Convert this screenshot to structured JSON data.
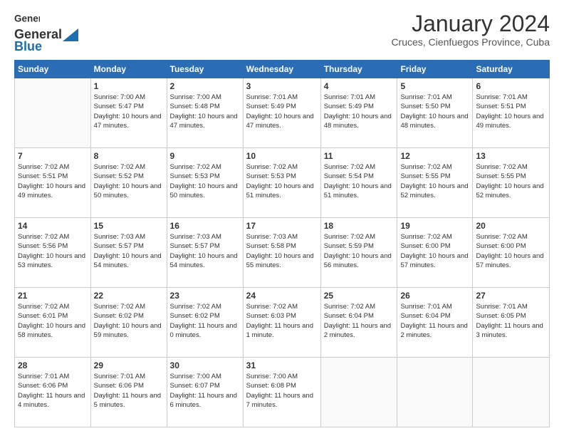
{
  "header": {
    "logo_general": "General",
    "logo_blue": "Blue",
    "month_title": "January 2024",
    "location": "Cruces, Cienfuegos Province, Cuba"
  },
  "weekdays": [
    "Sunday",
    "Monday",
    "Tuesday",
    "Wednesday",
    "Thursday",
    "Friday",
    "Saturday"
  ],
  "weeks": [
    [
      {
        "day": "",
        "sunrise": "",
        "sunset": "",
        "daylight": ""
      },
      {
        "day": "1",
        "sunrise": "Sunrise: 7:00 AM",
        "sunset": "Sunset: 5:47 PM",
        "daylight": "Daylight: 10 hours and 47 minutes."
      },
      {
        "day": "2",
        "sunrise": "Sunrise: 7:00 AM",
        "sunset": "Sunset: 5:48 PM",
        "daylight": "Daylight: 10 hours and 47 minutes."
      },
      {
        "day": "3",
        "sunrise": "Sunrise: 7:01 AM",
        "sunset": "Sunset: 5:49 PM",
        "daylight": "Daylight: 10 hours and 47 minutes."
      },
      {
        "day": "4",
        "sunrise": "Sunrise: 7:01 AM",
        "sunset": "Sunset: 5:49 PM",
        "daylight": "Daylight: 10 hours and 48 minutes."
      },
      {
        "day": "5",
        "sunrise": "Sunrise: 7:01 AM",
        "sunset": "Sunset: 5:50 PM",
        "daylight": "Daylight: 10 hours and 48 minutes."
      },
      {
        "day": "6",
        "sunrise": "Sunrise: 7:01 AM",
        "sunset": "Sunset: 5:51 PM",
        "daylight": "Daylight: 10 hours and 49 minutes."
      }
    ],
    [
      {
        "day": "7",
        "sunrise": "Sunrise: 7:02 AM",
        "sunset": "Sunset: 5:51 PM",
        "daylight": "Daylight: 10 hours and 49 minutes."
      },
      {
        "day": "8",
        "sunrise": "Sunrise: 7:02 AM",
        "sunset": "Sunset: 5:52 PM",
        "daylight": "Daylight: 10 hours and 50 minutes."
      },
      {
        "day": "9",
        "sunrise": "Sunrise: 7:02 AM",
        "sunset": "Sunset: 5:53 PM",
        "daylight": "Daylight: 10 hours and 50 minutes."
      },
      {
        "day": "10",
        "sunrise": "Sunrise: 7:02 AM",
        "sunset": "Sunset: 5:53 PM",
        "daylight": "Daylight: 10 hours and 51 minutes."
      },
      {
        "day": "11",
        "sunrise": "Sunrise: 7:02 AM",
        "sunset": "Sunset: 5:54 PM",
        "daylight": "Daylight: 10 hours and 51 minutes."
      },
      {
        "day": "12",
        "sunrise": "Sunrise: 7:02 AM",
        "sunset": "Sunset: 5:55 PM",
        "daylight": "Daylight: 10 hours and 52 minutes."
      },
      {
        "day": "13",
        "sunrise": "Sunrise: 7:02 AM",
        "sunset": "Sunset: 5:55 PM",
        "daylight": "Daylight: 10 hours and 52 minutes."
      }
    ],
    [
      {
        "day": "14",
        "sunrise": "Sunrise: 7:02 AM",
        "sunset": "Sunset: 5:56 PM",
        "daylight": "Daylight: 10 hours and 53 minutes."
      },
      {
        "day": "15",
        "sunrise": "Sunrise: 7:03 AM",
        "sunset": "Sunset: 5:57 PM",
        "daylight": "Daylight: 10 hours and 54 minutes."
      },
      {
        "day": "16",
        "sunrise": "Sunrise: 7:03 AM",
        "sunset": "Sunset: 5:57 PM",
        "daylight": "Daylight: 10 hours and 54 minutes."
      },
      {
        "day": "17",
        "sunrise": "Sunrise: 7:03 AM",
        "sunset": "Sunset: 5:58 PM",
        "daylight": "Daylight: 10 hours and 55 minutes."
      },
      {
        "day": "18",
        "sunrise": "Sunrise: 7:02 AM",
        "sunset": "Sunset: 5:59 PM",
        "daylight": "Daylight: 10 hours and 56 minutes."
      },
      {
        "day": "19",
        "sunrise": "Sunrise: 7:02 AM",
        "sunset": "Sunset: 6:00 PM",
        "daylight": "Daylight: 10 hours and 57 minutes."
      },
      {
        "day": "20",
        "sunrise": "Sunrise: 7:02 AM",
        "sunset": "Sunset: 6:00 PM",
        "daylight": "Daylight: 10 hours and 57 minutes."
      }
    ],
    [
      {
        "day": "21",
        "sunrise": "Sunrise: 7:02 AM",
        "sunset": "Sunset: 6:01 PM",
        "daylight": "Daylight: 10 hours and 58 minutes."
      },
      {
        "day": "22",
        "sunrise": "Sunrise: 7:02 AM",
        "sunset": "Sunset: 6:02 PM",
        "daylight": "Daylight: 10 hours and 59 minutes."
      },
      {
        "day": "23",
        "sunrise": "Sunrise: 7:02 AM",
        "sunset": "Sunset: 6:02 PM",
        "daylight": "Daylight: 11 hours and 0 minutes."
      },
      {
        "day": "24",
        "sunrise": "Sunrise: 7:02 AM",
        "sunset": "Sunset: 6:03 PM",
        "daylight": "Daylight: 11 hours and 1 minute."
      },
      {
        "day": "25",
        "sunrise": "Sunrise: 7:02 AM",
        "sunset": "Sunset: 6:04 PM",
        "daylight": "Daylight: 11 hours and 2 minutes."
      },
      {
        "day": "26",
        "sunrise": "Sunrise: 7:01 AM",
        "sunset": "Sunset: 6:04 PM",
        "daylight": "Daylight: 11 hours and 2 minutes."
      },
      {
        "day": "27",
        "sunrise": "Sunrise: 7:01 AM",
        "sunset": "Sunset: 6:05 PM",
        "daylight": "Daylight: 11 hours and 3 minutes."
      }
    ],
    [
      {
        "day": "28",
        "sunrise": "Sunrise: 7:01 AM",
        "sunset": "Sunset: 6:06 PM",
        "daylight": "Daylight: 11 hours and 4 minutes."
      },
      {
        "day": "29",
        "sunrise": "Sunrise: 7:01 AM",
        "sunset": "Sunset: 6:06 PM",
        "daylight": "Daylight: 11 hours and 5 minutes."
      },
      {
        "day": "30",
        "sunrise": "Sunrise: 7:00 AM",
        "sunset": "Sunset: 6:07 PM",
        "daylight": "Daylight: 11 hours and 6 minutes."
      },
      {
        "day": "31",
        "sunrise": "Sunrise: 7:00 AM",
        "sunset": "Sunset: 6:08 PM",
        "daylight": "Daylight: 11 hours and 7 minutes."
      },
      {
        "day": "",
        "sunrise": "",
        "sunset": "",
        "daylight": ""
      },
      {
        "day": "",
        "sunrise": "",
        "sunset": "",
        "daylight": ""
      },
      {
        "day": "",
        "sunrise": "",
        "sunset": "",
        "daylight": ""
      }
    ]
  ]
}
